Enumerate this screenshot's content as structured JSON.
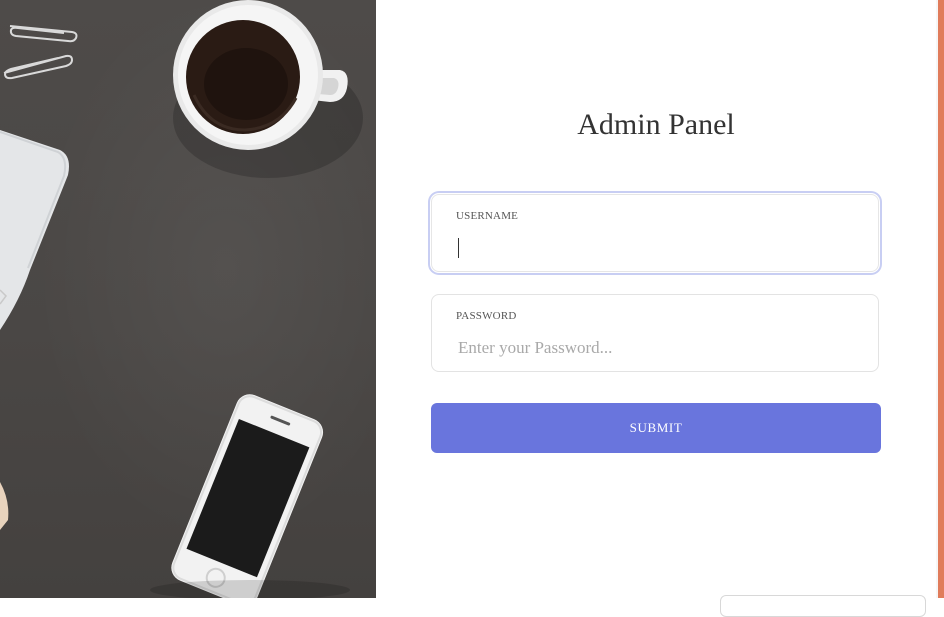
{
  "title": "Admin Panel",
  "form": {
    "username": {
      "label": "USERNAME",
      "value": "",
      "placeholder": ""
    },
    "password": {
      "label": "PASSWORD",
      "value": "",
      "placeholder": "Enter your Password..."
    },
    "submit_label": "SUBMIT"
  },
  "colors": {
    "accent": "#6975dd",
    "focus_ring": "#c8cef3",
    "right_edge": "#e07c5b",
    "photo_background": "#4a4745"
  }
}
